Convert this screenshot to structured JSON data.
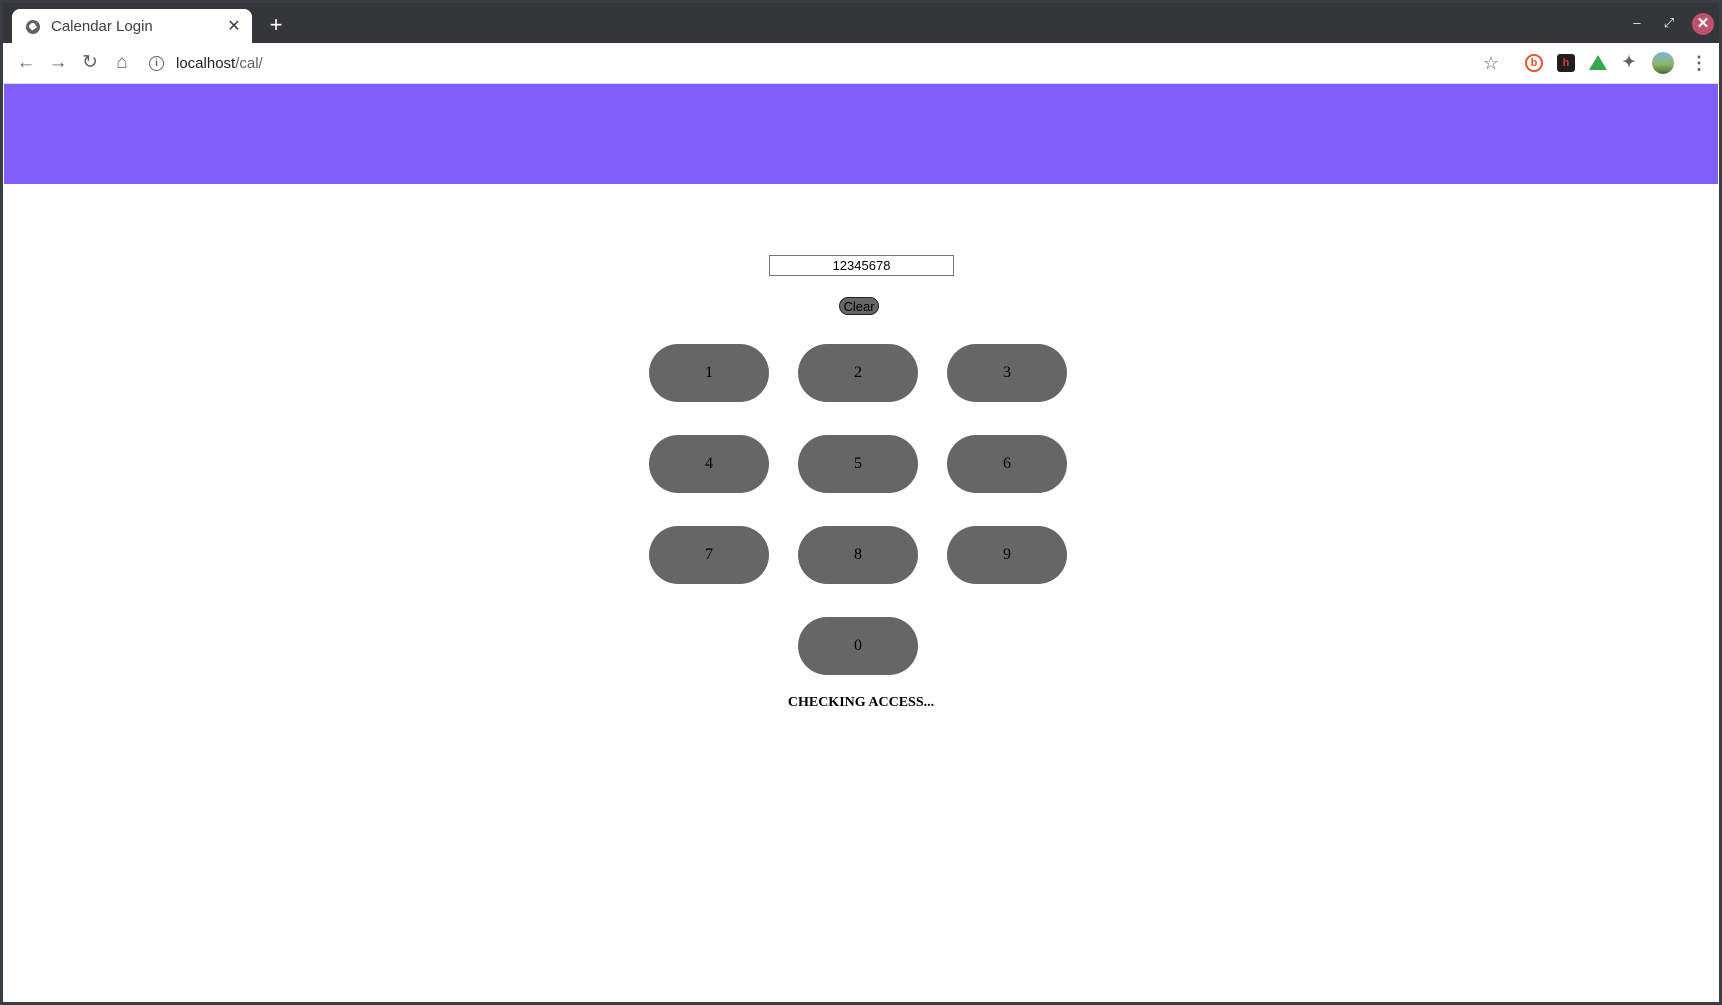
{
  "browser": {
    "tab_title": "Calendar Login",
    "tab_close": "✕",
    "new_tab": "+",
    "url_host": "localhost",
    "url_path": "/cal/",
    "window_controls": {
      "minimize": "–",
      "maximize": "⤢",
      "close": "✕"
    },
    "extensions": [
      "bitly-icon",
      "h-extension-icon",
      "google-drive-icon",
      "puzzle-icon"
    ],
    "avatar": "profile-avatar"
  },
  "banner": {
    "color": "#7f5ef9"
  },
  "login": {
    "code_value": "12345678",
    "clear_label": "Clear",
    "keys": [
      "1",
      "2",
      "3",
      "4",
      "5",
      "6",
      "7",
      "8",
      "9",
      "0"
    ],
    "status_text": "CHECKING ACCESS..."
  },
  "colors": {
    "key_bg": "#666666",
    "page_bg": "#ffffff"
  }
}
